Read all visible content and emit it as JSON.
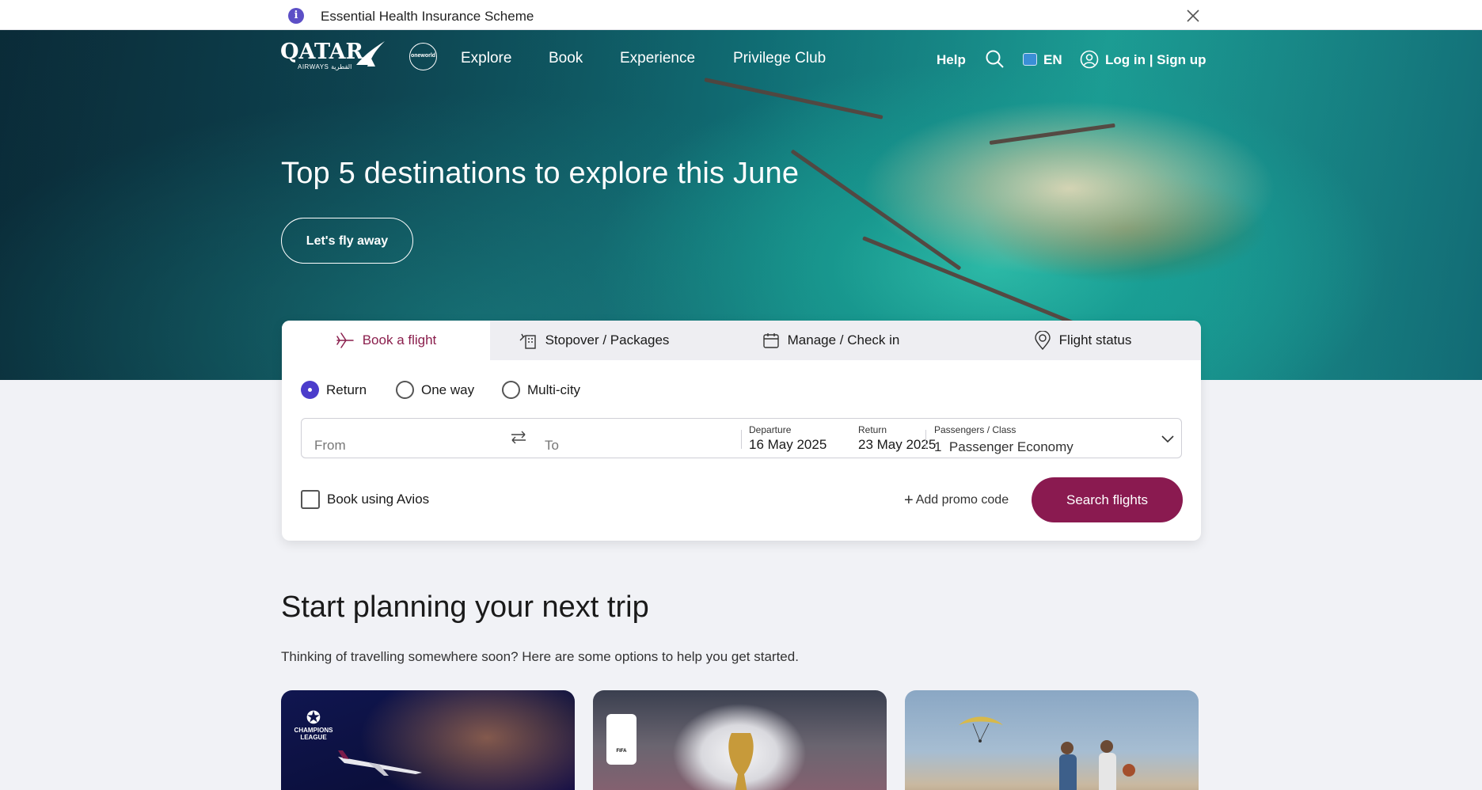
{
  "alert": {
    "text": "Essential Health Insurance Scheme",
    "icon": "info-icon",
    "close_icon": "close-icon"
  },
  "nav": {
    "logo_text": "QATAR",
    "logo_sub": "AIRWAYS القطرية",
    "alliance_badge": "oneworld",
    "items": [
      "Explore",
      "Book",
      "Experience",
      "Privilege Club"
    ],
    "help": "Help",
    "language": "EN",
    "login": "Log in | Sign up"
  },
  "hero": {
    "title": "Top 5 destinations to explore this June",
    "cta": "Let's fly away"
  },
  "booking": {
    "tabs": [
      {
        "label": "Book a flight",
        "icon": "plane-icon",
        "active": true
      },
      {
        "label": "Stopover / Packages",
        "icon": "hotel-icon",
        "active": false
      },
      {
        "label": "Manage / Check in",
        "icon": "calendar-icon",
        "active": false
      },
      {
        "label": "Flight status",
        "icon": "location-pin-icon",
        "active": false
      }
    ],
    "trip_types": [
      {
        "label": "Return",
        "selected": true
      },
      {
        "label": "One way",
        "selected": false
      },
      {
        "label": "Multi-city",
        "selected": false
      }
    ],
    "from_placeholder": "From",
    "to_placeholder": "To",
    "departure_label": "Departure",
    "departure_value": "16 May 2025",
    "return_label": "Return",
    "return_value": "23 May 2025",
    "passengers_label": "Passengers / Class",
    "passengers_value": "1  Passenger Economy",
    "avios_label": "Book using Avios",
    "promo_label": "Add promo code",
    "search_button": "Search flights"
  },
  "planning": {
    "title": "Start planning your next trip",
    "subtitle": "Thinking of travelling somewhere soon? Here are some options to help you get started.",
    "card1_badge": "CHAMPIONS LEAGUE",
    "card2_badge": "FIFA"
  },
  "colors": {
    "brand": "#8a1a50",
    "radio_selected": "#4b3ccb",
    "info": "#5c4fc6"
  }
}
